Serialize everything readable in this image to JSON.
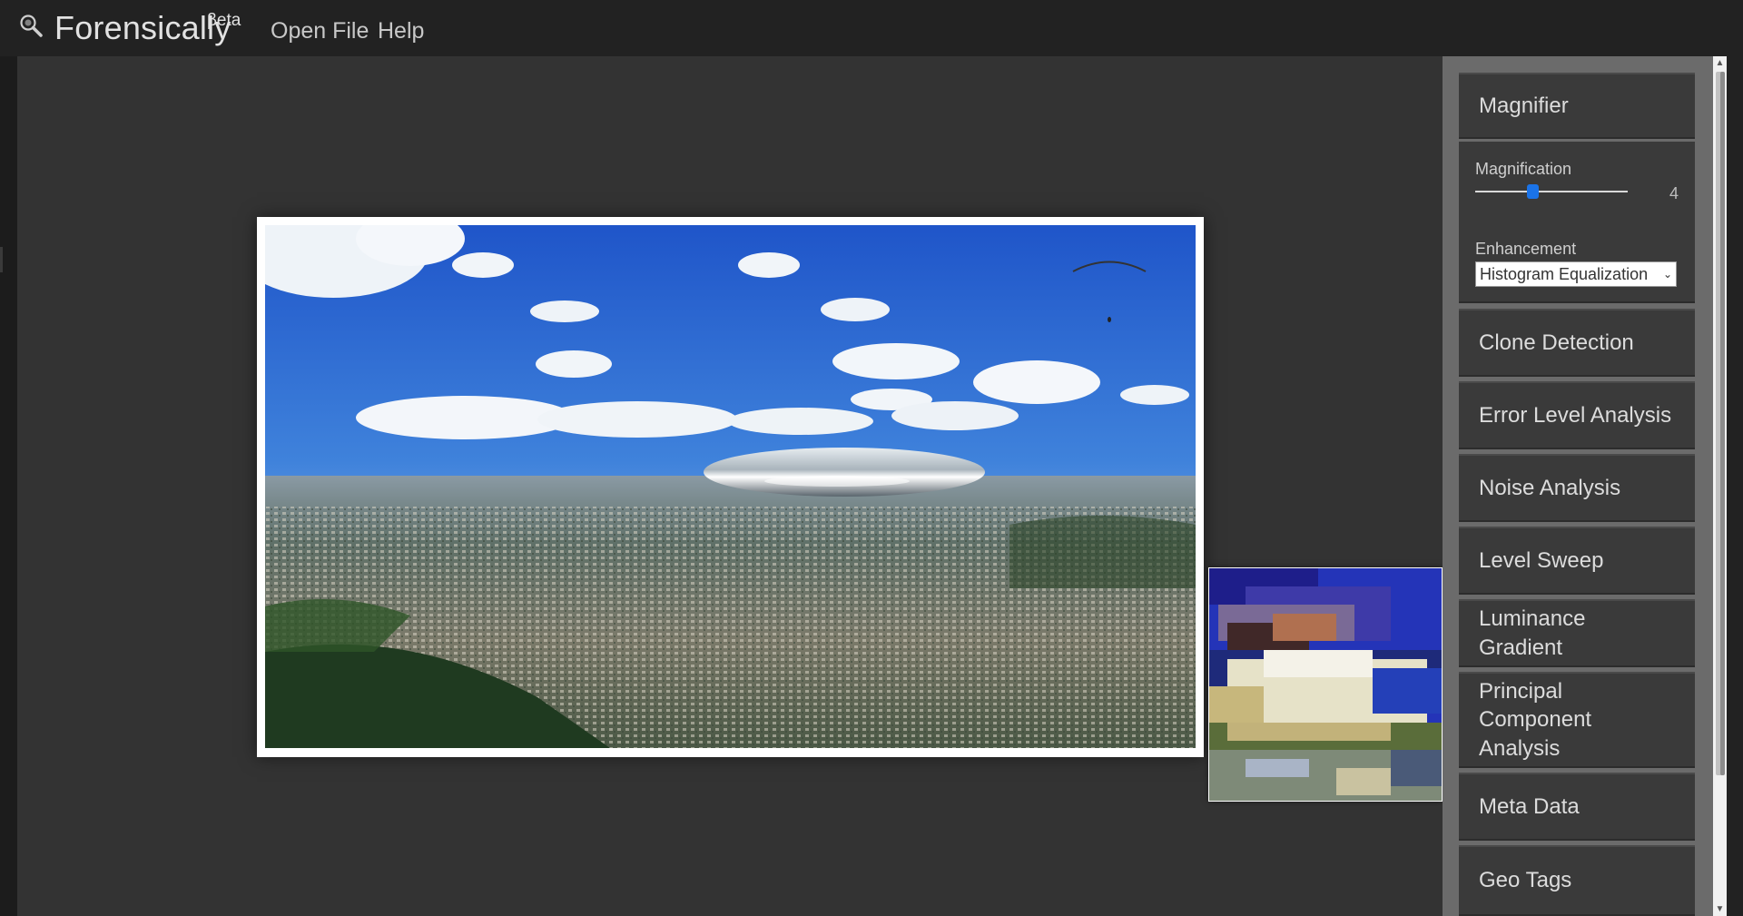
{
  "app": {
    "title": "Forensically",
    "beta": "βeta"
  },
  "nav": {
    "open_file": "Open File",
    "help": "Help"
  },
  "magnifier": {
    "title": "Magnifier",
    "magnification_label": "Magnification",
    "magnification_value": "4",
    "enhancement_label": "Enhancement",
    "enhancement_selected": "Histogram Equalization"
  },
  "tools": [
    {
      "label": "Clone Detection"
    },
    {
      "label": "Error Level Analysis"
    },
    {
      "label": "Noise Analysis"
    },
    {
      "label": "Level Sweep"
    },
    {
      "label": "Luminance Gradient"
    },
    {
      "label": "Principal Component Analysis"
    },
    {
      "label": "Meta Data"
    },
    {
      "label": "Geo Tags"
    }
  ],
  "colors": {
    "background": "#222222",
    "canvas": "#333333",
    "sidebar": "#6b6b6b",
    "tool_button": "#3a3a3a",
    "slider_accent": "#1a73e8"
  },
  "icons": {
    "logo": "magnifier-icon",
    "scroll_up": "up-arrow-icon",
    "scroll_down": "down-arrow-icon",
    "select": "chevron-down-icon"
  }
}
